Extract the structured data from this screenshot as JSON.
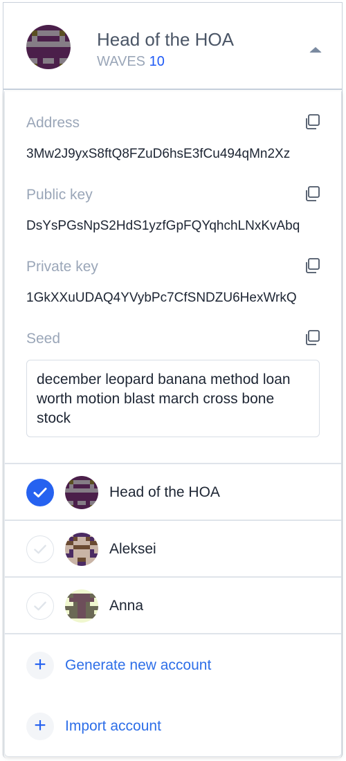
{
  "header": {
    "name": "Head of the HOA",
    "currency": "WAVES",
    "balance": "10"
  },
  "details": {
    "address": {
      "label": "Address",
      "value": "3Mw2J9yxS8ftQ8FZuD6hsE3fCu494qMn2Xz"
    },
    "public_key": {
      "label": "Public key",
      "value": "DsYsPGsNpS2HdS1yzfGpFQYqhchLNxKvAbq"
    },
    "private_key": {
      "label": "Private key",
      "value": "1GkXXuUDAQ4YVybPc7CfSNDZU6HexWrkQ"
    },
    "seed": {
      "label": "Seed",
      "value": "december leopard banana method loan worth motion blast march cross bone stock"
    }
  },
  "accounts": [
    {
      "name": "Head of the HOA",
      "selected": true
    },
    {
      "name": "Aleksei",
      "selected": false
    },
    {
      "name": "Anna",
      "selected": false
    }
  ],
  "actions": {
    "generate": "Generate new account",
    "import": "Import account"
  },
  "colors": {
    "accent": "#2662f0",
    "link": "#2d6ee8"
  }
}
